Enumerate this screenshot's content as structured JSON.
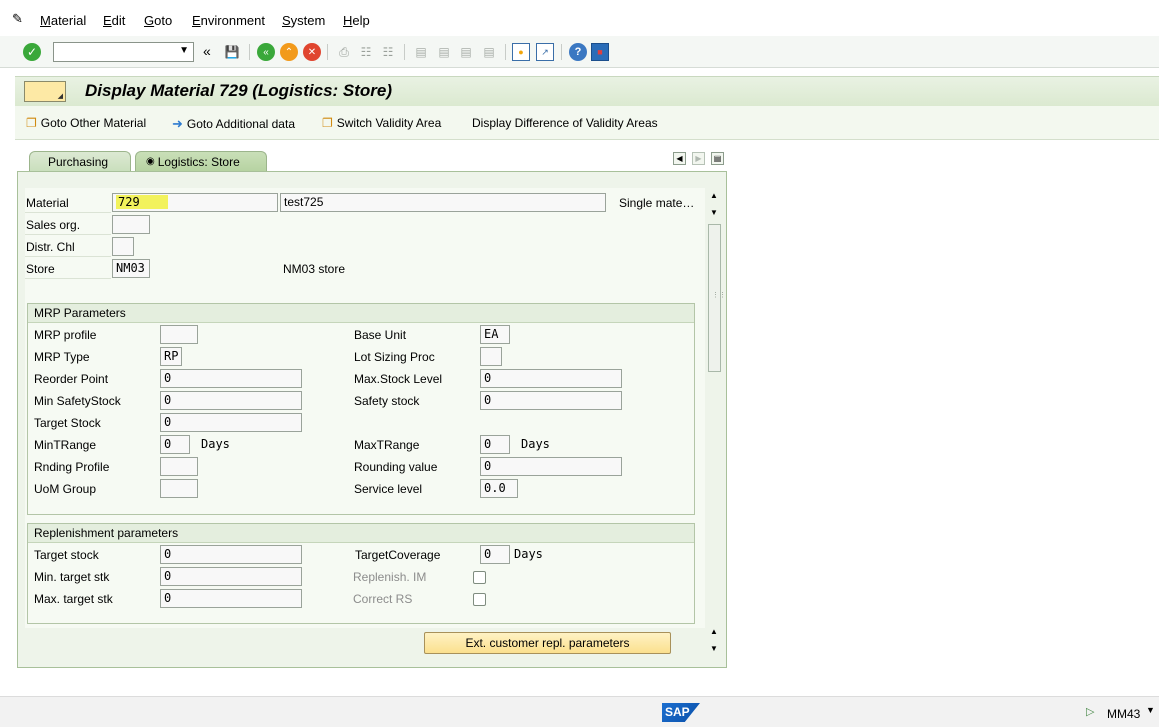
{
  "menu": {
    "items": [
      "Material",
      "Edit",
      "Goto",
      "Environment",
      "System",
      "Help"
    ]
  },
  "toolbar": {
    "command_field_value": ""
  },
  "title": "Display Material 729 (Logistics: Store)",
  "app_toolbar": {
    "goto_other_material": "Goto Other Material",
    "goto_additional_data": "Goto Additional data",
    "switch_validity_area": "Switch Validity Area",
    "display_difference": "Display Difference of Validity Areas"
  },
  "tabs": {
    "purchasing": "Purchasing",
    "logistics_store": "Logistics: Store"
  },
  "header": {
    "material_label": "Material",
    "material_value": "729",
    "material_desc": "test725",
    "material_type": "Single mate…",
    "sales_org_label": "Sales org.",
    "sales_org_value": "",
    "distr_chl_label": "Distr. Chl",
    "distr_chl_value": "",
    "store_label": "Store",
    "store_value": "NM03",
    "store_desc": "NM03 store"
  },
  "mrp": {
    "title": "MRP Parameters",
    "mrp_profile_label": "MRP profile",
    "mrp_profile_value": "",
    "mrp_type_label": "MRP Type",
    "mrp_type_value": "RP",
    "reorder_point_label": "Reorder Point",
    "reorder_point_value": "0",
    "min_safety_label": "Min SafetyStock",
    "min_safety_value": "0",
    "target_stock_label": "Target Stock",
    "target_stock_value": "0",
    "min_trange_label": "MinTRange",
    "min_trange_value": "0",
    "min_trange_unit": "Days",
    "rnding_profile_label": "Rnding Profile",
    "rnding_profile_value": "",
    "uom_group_label": "UoM Group",
    "uom_group_value": "",
    "base_unit_label": "Base Unit",
    "base_unit_value": "EA",
    "lot_sizing_label": "Lot Sizing Proc",
    "lot_sizing_value": "",
    "max_stock_label": "Max.Stock Level",
    "max_stock_value": "0",
    "safety_stock_label": "Safety stock",
    "safety_stock_value": "0",
    "max_trange_label": "MaxTRange",
    "max_trange_value": "0",
    "max_trange_unit": "Days",
    "rounding_value_label": "Rounding value",
    "rounding_value_value": "0",
    "service_level_label": "Service level",
    "service_level_value": "0.0"
  },
  "replenishment": {
    "title": "Replenishment parameters",
    "target_stock_label": "Target stock",
    "target_stock_value": "0",
    "min_target_label": "Min. target stk",
    "min_target_value": "0",
    "max_target_label": "Max. target stk",
    "max_target_value": "0",
    "target_coverage_label": "TargetCoverage",
    "target_coverage_value": "0",
    "target_coverage_unit": "Days",
    "replenish_im_label": "Replenish. IM",
    "correct_rs_label": "Correct RS"
  },
  "ext_button": "Ext. customer repl. parameters",
  "status": {
    "transaction": "MM43",
    "logo": "SAP"
  },
  "colors": {
    "accent_green": "#dbe9d0",
    "highlight": "#f0f028",
    "button_yellow": "#fde9a5"
  }
}
